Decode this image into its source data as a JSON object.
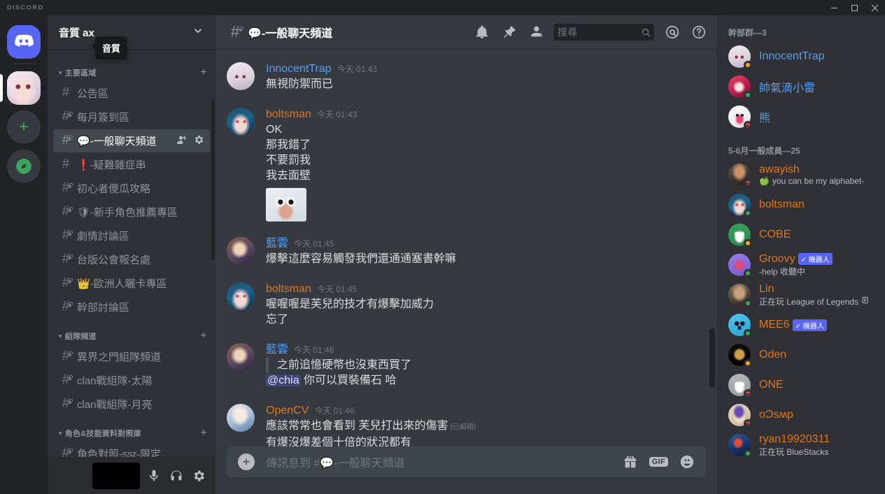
{
  "window": {
    "wordmark": "DISCORD",
    "minimize_label": "—",
    "maximize_label": "□",
    "close_label": "×"
  },
  "rail": {
    "home_name": "Discord",
    "add_server_label": "+",
    "explore_label": "compass"
  },
  "sidebar": {
    "server_name": "音質 ax",
    "server_tooltip": "音質",
    "categories": [
      {
        "label": "主要區域",
        "channels": [
          {
            "name": "公告區",
            "locked": false,
            "active": false
          },
          {
            "name": "每月簽到區",
            "locked": true,
            "active": false
          },
          {
            "name": "💬-一般聊天頻道",
            "locked": true,
            "active": true
          },
          {
            "name": "❗-疑難雜症串",
            "locked": false,
            "active": false
          },
          {
            "name": "初心者傻瓜攻略",
            "locked": true,
            "active": false
          },
          {
            "name": "🛡-新手角色推薦專區",
            "locked": true,
            "active": false
          },
          {
            "name": "劇情討論區",
            "locked": true,
            "active": false
          },
          {
            "name": "台版公會報名處",
            "locked": true,
            "active": false
          },
          {
            "name": "👑-歐洲人曬卡專區",
            "locked": true,
            "active": false
          },
          {
            "name": "幹部討論區",
            "locked": true,
            "active": false
          }
        ]
      },
      {
        "label": "組隊頻道",
        "channels": [
          {
            "name": "異界之門組隊頻道",
            "locked": true,
            "active": false
          },
          {
            "name": "clan戰組隊-太陽",
            "locked": true,
            "active": false
          },
          {
            "name": "clan戰組隊-月亮",
            "locked": true,
            "active": false
          }
        ]
      },
      {
        "label": "角色&技能資料對照庫",
        "channels": [
          {
            "name": "角色對照-ssr-限定",
            "locked": true,
            "active": false
          }
        ]
      }
    ],
    "add_channel_label": "+",
    "channel_settings_title": "編輯頻道",
    "channel_invite_title": "建立邀請"
  },
  "userpanel": {
    "name_redacted": true,
    "mute_title": "麥克風靜音",
    "deafen_title": "拒聽",
    "settings_title": "使用者設定"
  },
  "header": {
    "channel_name": "💬-一般聊天頻道",
    "notification_title": "通知設定",
    "pinned_title": "已釘選訊息",
    "members_title": "顯示成員名單",
    "search_placeholder": "搜尋",
    "inbox_title": "收件匣",
    "help_title": "幫助"
  },
  "messages": [
    {
      "author": "InnocentTrap",
      "color": "#5c9ce6",
      "timestamp": "今天 01:43",
      "lines": [
        "無視防禦而已"
      ],
      "avatar": "white-hair-anime",
      "sticker": false
    },
    {
      "author": "boltsman",
      "color": "#e0761a",
      "timestamp": "今天 01:43",
      "lines": [
        "OK",
        "那我錯了",
        "不要罰我",
        "我去面壁"
      ],
      "avatar": "blue-hair-anime",
      "sticker": true
    },
    {
      "author": "藍雲",
      "color": "#5c9ce6",
      "timestamp": "今天 01:45",
      "lines": [
        "爆擊這麼容易觸發我們還通通塞書幹嘛"
      ],
      "avatar": "brown-hair-anime",
      "sticker": false
    },
    {
      "author": "boltsman",
      "color": "#e0761a",
      "timestamp": "今天 01:45",
      "lines": [
        "喔喔喔是芙兒的技才有爆擊加威力",
        "忘了"
      ],
      "avatar": "blue-hair-anime",
      "sticker": false
    },
    {
      "author": "藍雲",
      "color": "#5c9ce6",
      "timestamp": "今天 01:46",
      "quote": "之前追憶硬幣也沒東西買了",
      "mention": "@chia",
      "mention_rest": " 你可以買裝備石 哈",
      "lines": [],
      "avatar": "brown-hair-anime",
      "sticker": false
    },
    {
      "author": "OpenCV",
      "color": "#e0761a",
      "timestamp": "今天 01:46",
      "lines": [
        "應該常常也會看到 芙兒打出來的傷害",
        "有爆沒爆差個十倍的狀況都有"
      ],
      "edited": "(已編輯)",
      "avatar": "doll-anime",
      "sticker": false
    }
  ],
  "composer": {
    "placeholder": "傳訊息到 #💬-一般聊天頻道",
    "add_label": "+",
    "gift_title": "送禮物",
    "gif_label": "GIF",
    "emoji_title": "表情符號"
  },
  "members": {
    "groups": [
      {
        "label": "幹部群—3",
        "members": [
          {
            "name": "InnocentTrap",
            "color": "#5c9ce6",
            "status": "idle",
            "sub": "",
            "bot": false,
            "avatar": "white-hair-anime"
          },
          {
            "name": "帥氣滴小雷",
            "color": "#5c9ce6",
            "status": "online",
            "sub": "",
            "bot": false,
            "avatar": "pink-hair-anime"
          },
          {
            "name": "熊",
            "color": "#5c9ce6",
            "status": "dnd",
            "sub": "",
            "bot": false,
            "avatar": "white-bear"
          }
        ]
      },
      {
        "label": "5-6月一般成員—25",
        "members": [
          {
            "name": "awayish",
            "color": "#e0761a",
            "status": "dnd",
            "sub": "you can be my alphabet-",
            "sub_emoji": "🍏",
            "bot": false,
            "avatar": "photo-person"
          },
          {
            "name": "boltsman",
            "color": "#e0761a",
            "status": "online",
            "sub": "",
            "bot": false,
            "avatar": "blue-hair-anime"
          },
          {
            "name": "COBE",
            "color": "#e0761a",
            "status": "idle",
            "sub": "",
            "bot": false,
            "avatar": "discord-green"
          },
          {
            "name": "Groovy",
            "color": "#e0761a",
            "status": "online",
            "sub": "-help 收聽中",
            "bot": true,
            "bot_label": "機器人",
            "avatar": "groovy-purple"
          },
          {
            "name": "Lin",
            "color": "#e0761a",
            "status": "online",
            "sub": "正在玩 League of Legends",
            "sub_icon": true,
            "bot": false,
            "avatar": "photo-person2"
          },
          {
            "name": "MEE6",
            "color": "#e0761a",
            "status": "online",
            "sub": "",
            "bot": true,
            "bot_label": "機器人",
            "avatar": "mee6-blue"
          },
          {
            "name": "Oden",
            "color": "#e0761a",
            "status": "idle",
            "sub": "",
            "bot": false,
            "avatar": "oden-black"
          },
          {
            "name": "ONE",
            "color": "#e0761a",
            "status": "dnd",
            "sub": "",
            "bot": false,
            "avatar": "discord-grey"
          },
          {
            "name": "oƆsʍp",
            "color": "#e0761a",
            "status": "dnd",
            "sub": "",
            "bot": false,
            "avatar": "santa-anime"
          },
          {
            "name": "ryan19920311",
            "color": "#e0761a",
            "status": "online",
            "sub": "正在玩 BlueStacks",
            "bot": false,
            "avatar": "blue-bird"
          }
        ]
      }
    ],
    "bot_check": "✓"
  },
  "colors": {
    "brand": "#5865f2",
    "online": "#3ba55d",
    "idle": "#faa61a",
    "dnd": "#ed4245",
    "bg_chat": "#36393f",
    "bg_sidebar": "#2f3136",
    "bg_rail": "#202225"
  }
}
